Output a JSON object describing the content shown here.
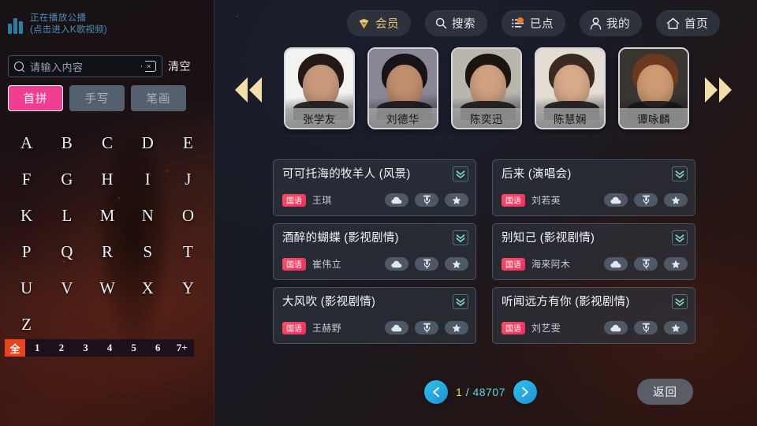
{
  "left_panel": {
    "now_playing": {
      "icon": "equalizer-bars-icon",
      "line1": "正在播放公播",
      "line2": "(点击进入K歌视频)"
    },
    "search": {
      "icon": "search-icon",
      "placeholder": "请输入内容",
      "value": "",
      "backspace_icon": "backspace-icon",
      "clear_label": "清空"
    },
    "ime_tabs": [
      {
        "label": "首拼",
        "active": true
      },
      {
        "label": "手写",
        "active": false
      },
      {
        "label": "笔画",
        "active": false
      }
    ],
    "alphabet": [
      "A",
      "B",
      "C",
      "D",
      "E",
      "F",
      "G",
      "H",
      "I",
      "J",
      "K",
      "L",
      "M",
      "N",
      "O",
      "P",
      "Q",
      "R",
      "S",
      "T",
      "U",
      "V",
      "W",
      "X",
      "Y",
      "Z"
    ],
    "word_count_filter": {
      "items": [
        "全",
        "1",
        "2",
        "3",
        "4",
        "5",
        "6",
        "7+"
      ],
      "active": "全"
    }
  },
  "topnav": {
    "items": [
      {
        "label": "会员",
        "icon": "vip-diamond-icon",
        "accent": "#e8c478"
      },
      {
        "label": "搜索",
        "icon": "search-icon"
      },
      {
        "label": "已点",
        "icon": "playlist-icon",
        "badge": true
      },
      {
        "label": "我的",
        "icon": "user-icon"
      },
      {
        "label": "首页",
        "icon": "home-icon"
      }
    ]
  },
  "carousel": {
    "prev_icon": "double-chevron-left-icon",
    "next_icon": "double-chevron-right-icon",
    "singers": [
      {
        "name": "张学友",
        "bg": "#f2f2f0",
        "skin": "#c99a7c",
        "hair": "#241a15"
      },
      {
        "name": "刘德华",
        "bg": "#8b8694",
        "skin": "#c08f6e",
        "hair": "#181318"
      },
      {
        "name": "陈奕迅",
        "bg": "#b9b6ae",
        "skin": "#cfa181",
        "hair": "#1b1410"
      },
      {
        "name": "陈慧娴",
        "bg": "#e4ddd4",
        "skin": "#d8ab8a",
        "hair": "#3a2a20"
      },
      {
        "name": "谭咏麟",
        "bg": "#3b3530",
        "skin": "#cf9b74",
        "hair": "#6b3a1e"
      }
    ]
  },
  "songs": [
    {
      "title": "可可托海的牧羊人 (风景)",
      "lang": "国语",
      "artist": "王琪"
    },
    {
      "title": "后来 (演唱会)",
      "lang": "国语",
      "artist": "刘若英"
    },
    {
      "title": "酒醉的蝴蝶 (影视剧情)",
      "lang": "国语",
      "artist": "崔伟立"
    },
    {
      "title": "别知己 (影视剧情)",
      "lang": "国语",
      "artist": "海来阿木"
    },
    {
      "title": "大风吹 (影视剧情)",
      "lang": "国语",
      "artist": "王赫野"
    },
    {
      "title": "听闻远方有你 (影视剧情)",
      "lang": "国语",
      "artist": "刘艺雯"
    }
  ],
  "song_actions": [
    {
      "icon": "cloud-icon"
    },
    {
      "icon": "microphone-icon"
    },
    {
      "icon": "star-icon"
    }
  ],
  "song_expand_icon": "double-chevron-down-icon",
  "footer": {
    "prev_icon": "chevron-left-icon",
    "next_icon": "chevron-right-icon",
    "page_current": "1",
    "page_separator": "/",
    "page_total": "48707",
    "back_label": "返回"
  },
  "colors": {
    "accent_pink": "#ef3d91",
    "accent_gold": "#e8c478",
    "accent_cyan": "#2ec3e8",
    "accent_red": "#e8421f",
    "badge_red": "#ef2f5e",
    "page_yellow": "#e8e33a"
  }
}
